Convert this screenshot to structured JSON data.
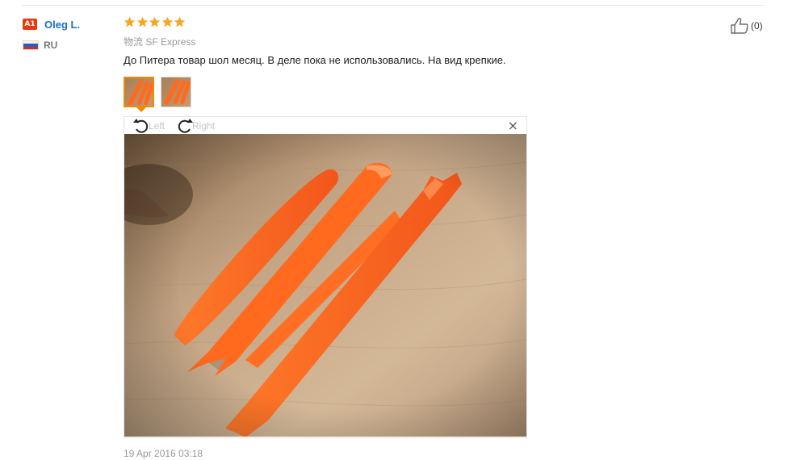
{
  "user": {
    "level_badge": "A1",
    "name": "Oleg L.",
    "country_code": "RU",
    "flag_icon": "russia-flag-icon"
  },
  "review": {
    "rating": 5,
    "star_color": "#f5a623",
    "logistics_label": "物流",
    "logistics_value": "SF Express",
    "text": "До Питера товар шол месяц. В деле пока не использовались. На вид крепкие.",
    "date": "19 Apr 2016 03:18",
    "photos": [
      {
        "name": "photo-thumbnail-1",
        "active": true
      },
      {
        "name": "photo-thumbnail-2",
        "active": false
      }
    ]
  },
  "viewer": {
    "rotate_left_label": "Left",
    "rotate_right_label": "Right",
    "close_glyph": "×"
  },
  "helpful": {
    "count_text": "(0)",
    "icon": "thumbs-up-icon"
  },
  "colors": {
    "accent": "#f08a00",
    "link": "#1a6fc2",
    "badge": "#e8390e",
    "tool_orange": "#ff6a1f"
  }
}
